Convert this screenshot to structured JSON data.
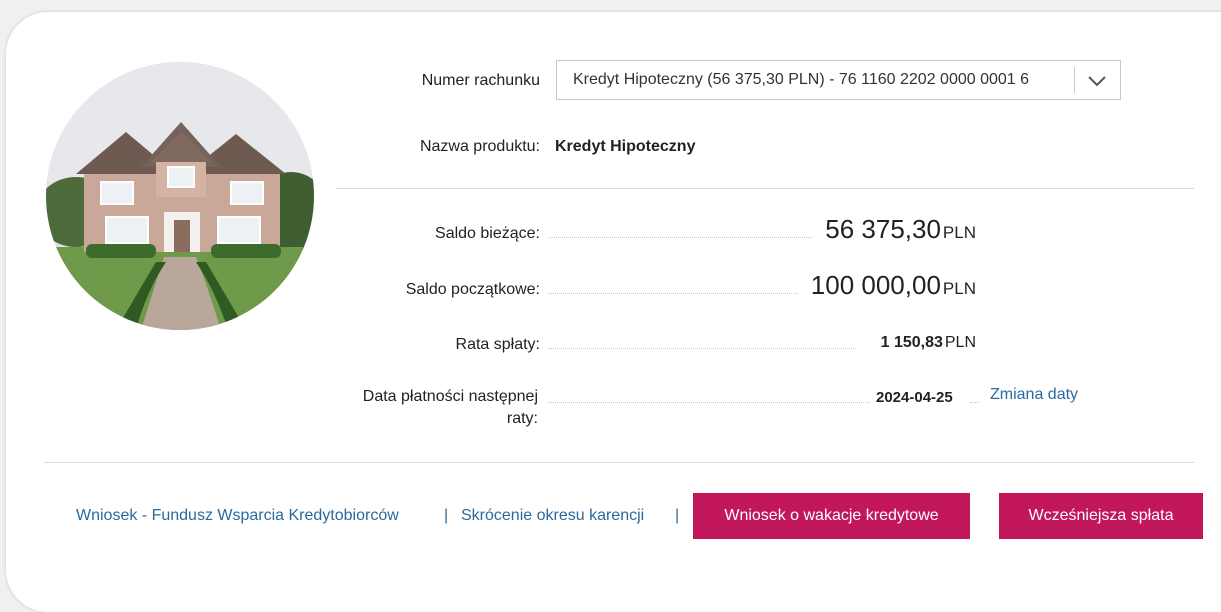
{
  "account": {
    "label": "Numer rachunku",
    "selected": "Kredyt Hipoteczny (56 375,30 PLN) - 76 1160 2202 0000 0001 6"
  },
  "product": {
    "label": "Nazwa produktu:",
    "value": "Kredyt Hipoteczny"
  },
  "balances": {
    "current_label": "Saldo bieżące:",
    "current_value": "56 375,30",
    "initial_label": "Saldo początkowe:",
    "initial_value": "100 000,00",
    "installment_label": "Rata spłaty:",
    "installment_value": "1 150,83",
    "currency": "PLN"
  },
  "next_payment": {
    "label_line1": "Data płatności następnej",
    "label_line2": "raty:",
    "date": "2024-04-25",
    "change_link": "Zmiana daty"
  },
  "footer": {
    "link1": "Wniosek - Fundusz Wsparcia Kredytobiorców",
    "separator": "|",
    "link2": "Skrócenie okresu karencji",
    "button1": "Wniosek o wakacje kredytowe",
    "button2": "Wcześniejsza spłata"
  },
  "colors": {
    "accent": "#c2185b",
    "link": "#2a6a9e"
  },
  "icons": {
    "dropdown": "chevron-down-icon",
    "image": "house-photo"
  }
}
